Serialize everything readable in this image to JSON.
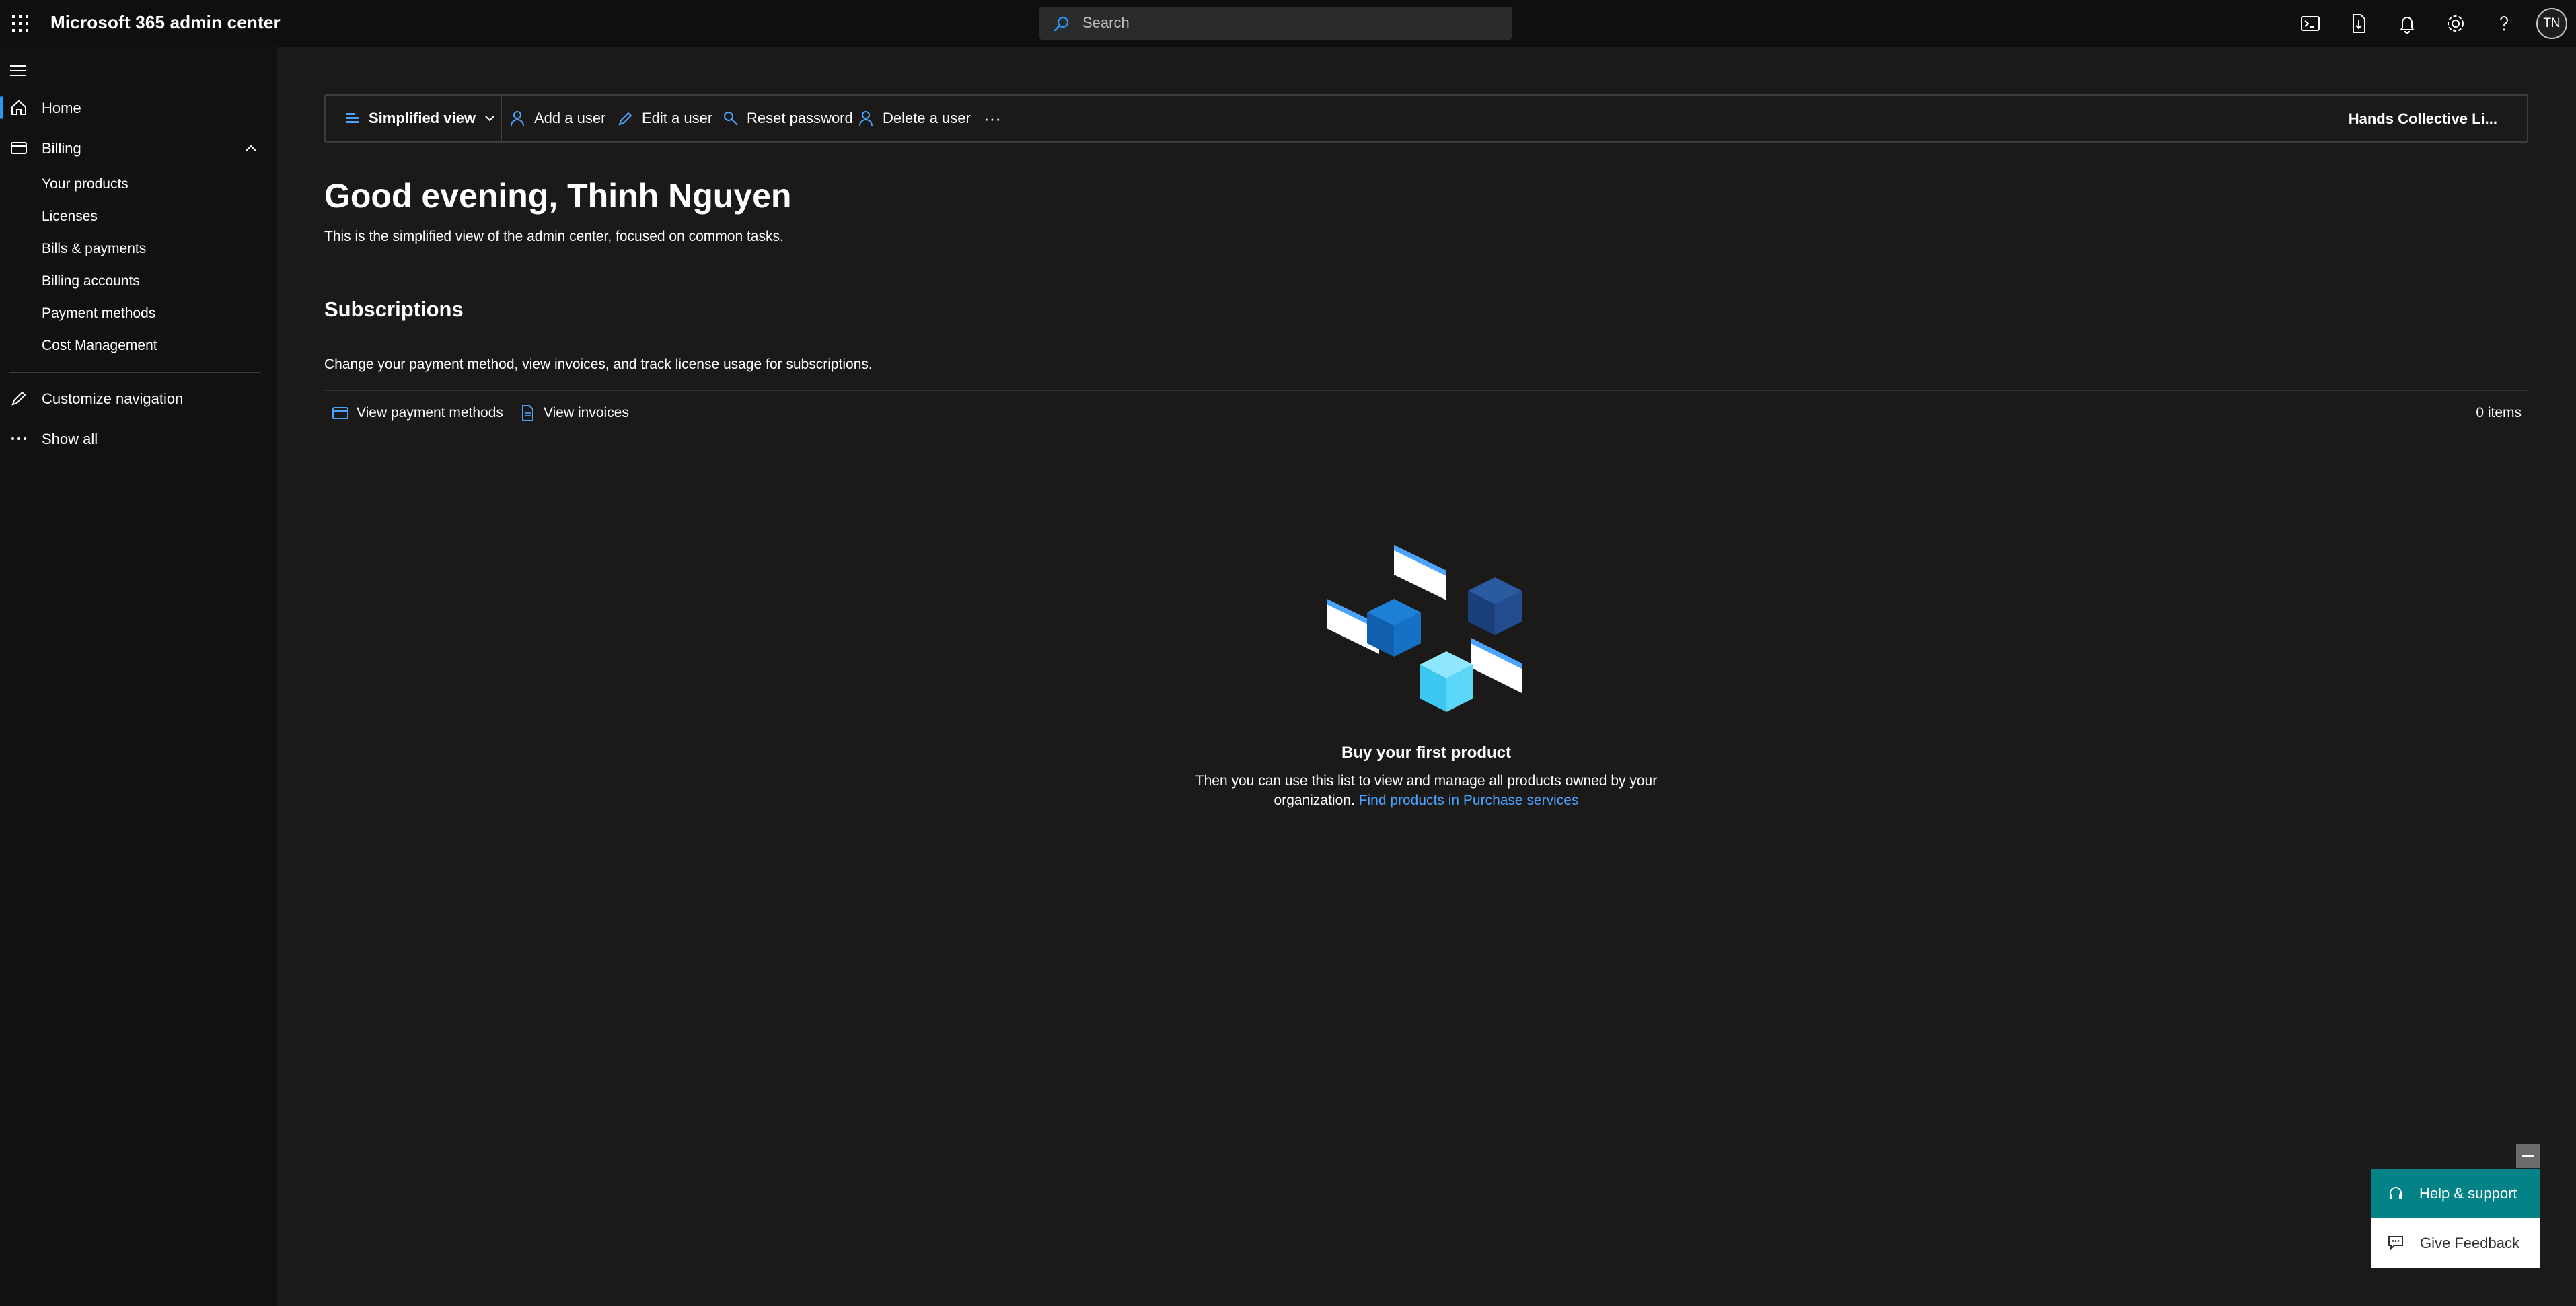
{
  "topbar": {
    "app_title": "Microsoft 365 admin center",
    "search_placeholder": "Search",
    "avatar_initials": "TN",
    "icons": [
      "app-launcher-icon",
      "terminal-icon",
      "download-app-icon",
      "bell-icon",
      "gear-icon",
      "help-icon"
    ]
  },
  "sidebar": {
    "items": [
      {
        "label": "Home",
        "icon": "home-icon",
        "active": true
      },
      {
        "label": "Billing",
        "icon": "billing-icon",
        "expanded": true
      }
    ],
    "billing_sub": [
      "Your products",
      "Licenses",
      "Bills & payments",
      "Billing accounts",
      "Payment methods",
      "Cost Management"
    ],
    "bottom": [
      {
        "label": "Customize navigation",
        "icon": "pencil-icon"
      },
      {
        "label": "Show all",
        "icon": "more-icon"
      }
    ]
  },
  "commandbar": {
    "view_label": "Simplified view",
    "add_user": "Add a user",
    "edit_user": "Edit a user",
    "reset_password": "Reset password",
    "delete_user": "Delete a user",
    "more": "···",
    "org_name": "Hands Collective Li..."
  },
  "main": {
    "greeting": "Good evening, Thinh Nguyen",
    "greeting_sub": "This is the simplified view of the admin center, focused on common tasks.",
    "subscriptions": {
      "title": "Subscriptions",
      "description": "Change your payment method, view invoices, and track license usage for subscriptions.",
      "view_payment_methods": "View payment methods",
      "view_invoices": "View invoices",
      "items_count": "0 items"
    },
    "empty_state": {
      "title": "Buy your first product",
      "description": "Then you can use this list to view and manage all products owned by your organization.",
      "link": "Find products in Purchase services"
    }
  },
  "help_widget": {
    "help_label": "Help & support",
    "feedback_label": "Give Feedback"
  },
  "colors": {
    "background": "#1b1a19",
    "topbar": "#0f0f0f",
    "nav": "#111111",
    "accent": "#2899f5",
    "link": "#4aa3ff",
    "help_teal": "#038387"
  }
}
